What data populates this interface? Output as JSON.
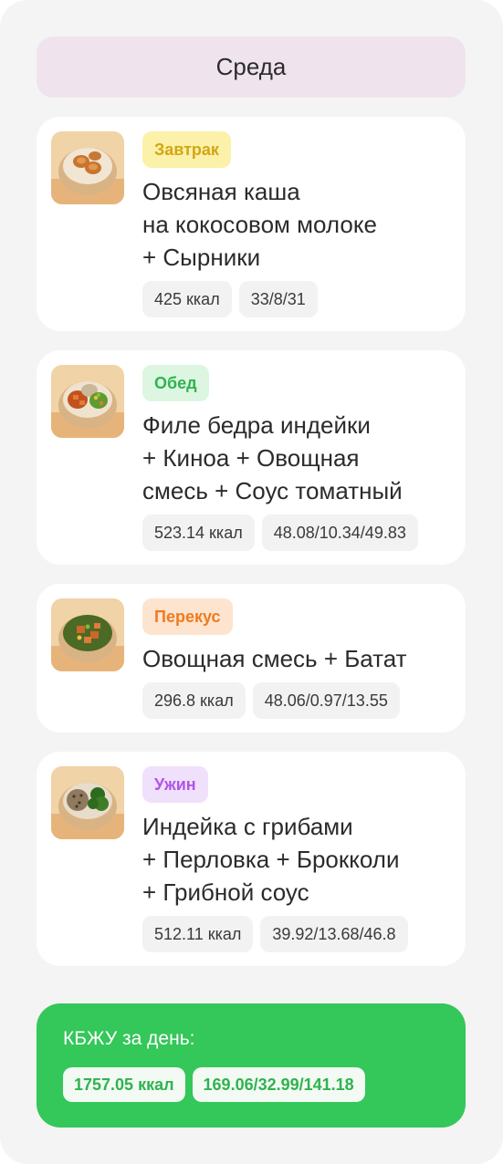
{
  "day": {
    "title": "Среда"
  },
  "meals": [
    {
      "tag": "Завтрак",
      "tag_bg": "#fbf1a9",
      "tag_color": "#d3a614",
      "title_lines": [
        "Овсяная каша",
        "на кокосовом молоке",
        "+ Сырники"
      ],
      "kcal": "425 ккал",
      "macros": "33/8/31",
      "image_icon": "oatmeal-bowl-icon"
    },
    {
      "tag": "Обед",
      "tag_bg": "#dcf6e1",
      "tag_color": "#2fb34f",
      "title_lines": [
        "Филе бедра индейки",
        "+ Киноа + Овощная",
        "смесь + Соус томатный"
      ],
      "kcal": "523.14 ккал",
      "macros": "48.08/10.34/49.83",
      "image_icon": "turkey-quinoa-bowl-icon"
    },
    {
      "tag": "Перекус",
      "tag_bg": "#fde4cf",
      "tag_color": "#f07a1e",
      "title_lines": [
        "Овощная смесь + Батат"
      ],
      "kcal": "296.8 ккал",
      "macros": "48.06/0.97/13.55",
      "image_icon": "vegetable-sweet-potato-bowl-icon"
    },
    {
      "tag": "Ужин",
      "tag_bg": "#efe0fb",
      "tag_color": "#b154e8",
      "title_lines": [
        "Индейка с грибами",
        "+ Перловка + Брокколи",
        "+ Грибной соус"
      ],
      "kcal": "512.11 ккал",
      "macros": "39.92/13.68/46.8",
      "image_icon": "turkey-barley-broccoli-bowl-icon"
    }
  ],
  "summary": {
    "title": "КБЖУ за день:",
    "kcal": "1757.05 ккал",
    "macros": "169.06/32.99/141.18"
  }
}
